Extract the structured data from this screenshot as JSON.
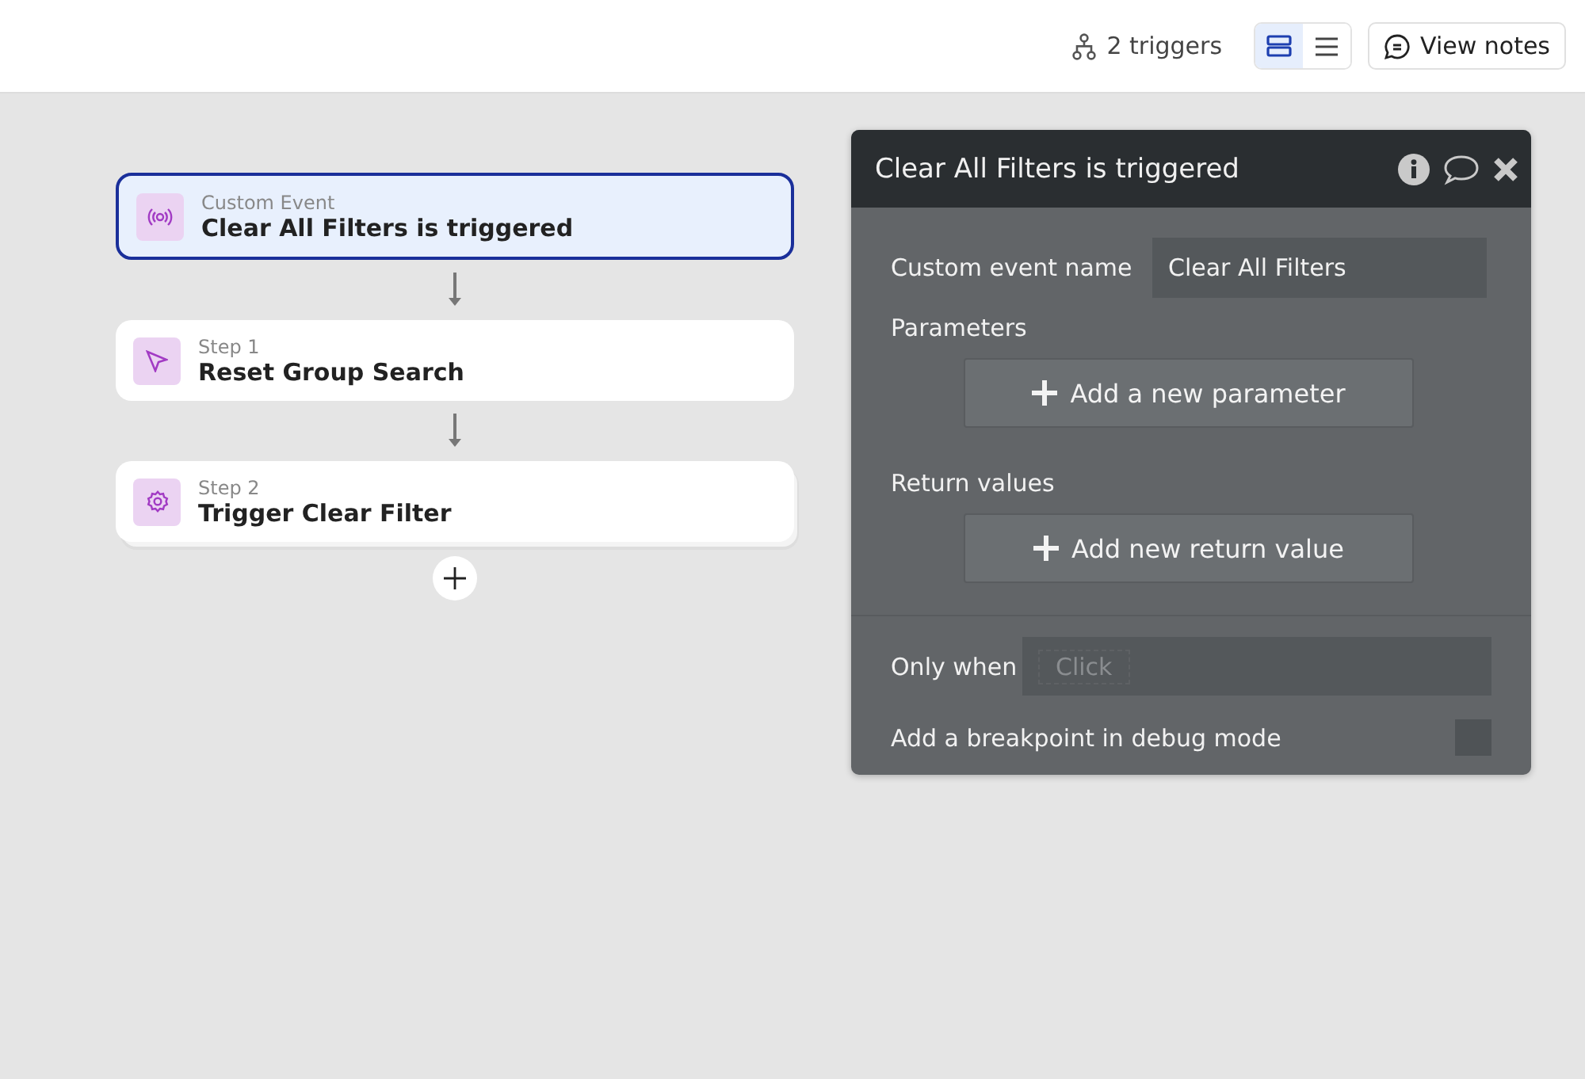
{
  "toolbar": {
    "triggers": "2 triggers",
    "view_modes": [
      {
        "kind": "cards",
        "selected": true
      },
      {
        "kind": "list",
        "selected": false
      }
    ],
    "notes_button": "View notes"
  },
  "flow": {
    "nodes": [
      {
        "kind": "event",
        "caption": "Custom Event",
        "title": "Clear All Filters is triggered",
        "selected": true,
        "stacked": false
      },
      {
        "kind": "pointer",
        "caption": "Step 1",
        "title": "Reset Group Search",
        "selected": false,
        "stacked": false
      },
      {
        "kind": "gear",
        "caption": "Step 2",
        "title": "Trigger Clear Filter",
        "selected": false,
        "stacked": true
      }
    ]
  },
  "panel": {
    "title": "Clear All Filters is triggered",
    "event_name": {
      "label": "Custom event name",
      "value": "Clear All Filters"
    },
    "parameters": {
      "label": "Parameters",
      "button": "Add a new parameter"
    },
    "return_values": {
      "label": "Return values",
      "button": "Add new return value"
    },
    "only_when": {
      "label": "Only when",
      "placeholder": "Click"
    },
    "breakpoint": {
      "label": "Add a breakpoint in debug mode",
      "checked": false
    }
  }
}
